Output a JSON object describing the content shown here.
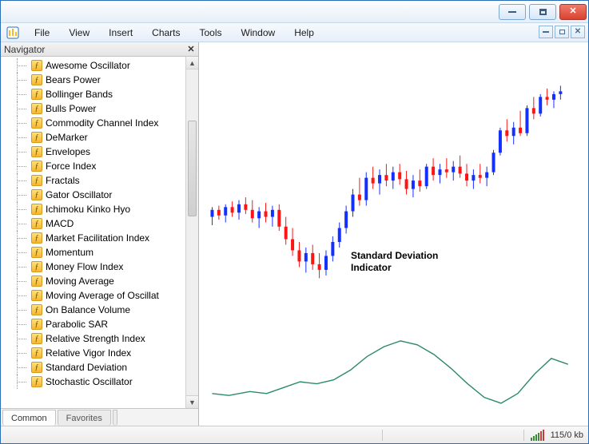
{
  "menubar": {
    "items": [
      "File",
      "View",
      "Insert",
      "Charts",
      "Tools",
      "Window",
      "Help"
    ]
  },
  "navigator": {
    "title": "Navigator",
    "indicators": [
      "Awesome Oscillator",
      "Bears Power",
      "Bollinger Bands",
      "Bulls Power",
      "Commodity Channel Index",
      "DeMarker",
      "Envelopes",
      "Force Index",
      "Fractals",
      "Gator Oscillator",
      "Ichimoku Kinko Hyo",
      "MACD",
      "Market Facilitation Index",
      "Momentum",
      "Money Flow Index",
      "Moving Average",
      "Moving Average of Oscillat",
      "On Balance Volume",
      "Parabolic SAR",
      "Relative Strength Index",
      "Relative Vigor Index",
      "Standard Deviation",
      "Stochastic Oscillator"
    ],
    "tabs": {
      "common": "Common",
      "favorites": "Favorites"
    }
  },
  "annotation": {
    "line1": "Standard Deviation",
    "line2": "Indicator"
  },
  "status": {
    "conn": "115/0 kb"
  },
  "chart_data": {
    "type": "candlestick+line",
    "colors": {
      "up": "#1430ff",
      "down": "#ff1414",
      "indicator": "#2c8a6a"
    },
    "ylim": [
      0,
      180
    ],
    "candles": [
      {
        "x": 10,
        "o": 92,
        "h": 99,
        "l": 86,
        "c": 97,
        "d": "up"
      },
      {
        "x": 18,
        "o": 97,
        "h": 100,
        "l": 90,
        "c": 93,
        "d": "down"
      },
      {
        "x": 26,
        "o": 93,
        "h": 101,
        "l": 88,
        "c": 99,
        "d": "up"
      },
      {
        "x": 34,
        "o": 99,
        "h": 103,
        "l": 92,
        "c": 95,
        "d": "down"
      },
      {
        "x": 42,
        "o": 95,
        "h": 104,
        "l": 90,
        "c": 101,
        "d": "up"
      },
      {
        "x": 50,
        "o": 101,
        "h": 106,
        "l": 94,
        "c": 97,
        "d": "down"
      },
      {
        "x": 58,
        "o": 97,
        "h": 104,
        "l": 88,
        "c": 91,
        "d": "down"
      },
      {
        "x": 66,
        "o": 91,
        "h": 99,
        "l": 84,
        "c": 96,
        "d": "up"
      },
      {
        "x": 74,
        "o": 96,
        "h": 102,
        "l": 88,
        "c": 92,
        "d": "down"
      },
      {
        "x": 82,
        "o": 92,
        "h": 100,
        "l": 85,
        "c": 97,
        "d": "up"
      },
      {
        "x": 90,
        "o": 97,
        "h": 101,
        "l": 82,
        "c": 85,
        "d": "down"
      },
      {
        "x": 98,
        "o": 85,
        "h": 92,
        "l": 72,
        "c": 76,
        "d": "down"
      },
      {
        "x": 106,
        "o": 76,
        "h": 84,
        "l": 64,
        "c": 68,
        "d": "down"
      },
      {
        "x": 114,
        "o": 68,
        "h": 74,
        "l": 56,
        "c": 60,
        "d": "down"
      },
      {
        "x": 122,
        "o": 60,
        "h": 70,
        "l": 52,
        "c": 66,
        "d": "up"
      },
      {
        "x": 130,
        "o": 66,
        "h": 72,
        "l": 54,
        "c": 58,
        "d": "down"
      },
      {
        "x": 138,
        "o": 58,
        "h": 66,
        "l": 48,
        "c": 54,
        "d": "down"
      },
      {
        "x": 146,
        "o": 54,
        "h": 68,
        "l": 50,
        "c": 64,
        "d": "up"
      },
      {
        "x": 154,
        "o": 64,
        "h": 78,
        "l": 60,
        "c": 74,
        "d": "up"
      },
      {
        "x": 162,
        "o": 74,
        "h": 88,
        "l": 70,
        "c": 84,
        "d": "up"
      },
      {
        "x": 170,
        "o": 84,
        "h": 100,
        "l": 80,
        "c": 96,
        "d": "up"
      },
      {
        "x": 178,
        "o": 96,
        "h": 112,
        "l": 92,
        "c": 108,
        "d": "up"
      },
      {
        "x": 186,
        "o": 108,
        "h": 120,
        "l": 100,
        "c": 104,
        "d": "down"
      },
      {
        "x": 194,
        "o": 104,
        "h": 124,
        "l": 100,
        "c": 120,
        "d": "up"
      },
      {
        "x": 202,
        "o": 120,
        "h": 128,
        "l": 112,
        "c": 116,
        "d": "down"
      },
      {
        "x": 210,
        "o": 116,
        "h": 126,
        "l": 108,
        "c": 122,
        "d": "up"
      },
      {
        "x": 218,
        "o": 122,
        "h": 130,
        "l": 114,
        "c": 118,
        "d": "down"
      },
      {
        "x": 226,
        "o": 118,
        "h": 128,
        "l": 112,
        "c": 124,
        "d": "up"
      },
      {
        "x": 234,
        "o": 124,
        "h": 130,
        "l": 115,
        "c": 119,
        "d": "down"
      },
      {
        "x": 242,
        "o": 119,
        "h": 125,
        "l": 108,
        "c": 112,
        "d": "down"
      },
      {
        "x": 250,
        "o": 112,
        "h": 122,
        "l": 106,
        "c": 118,
        "d": "up"
      },
      {
        "x": 258,
        "o": 118,
        "h": 126,
        "l": 110,
        "c": 114,
        "d": "down"
      },
      {
        "x": 266,
        "o": 114,
        "h": 130,
        "l": 112,
        "c": 128,
        "d": "up"
      },
      {
        "x": 274,
        "o": 128,
        "h": 134,
        "l": 118,
        "c": 122,
        "d": "down"
      },
      {
        "x": 282,
        "o": 122,
        "h": 130,
        "l": 116,
        "c": 126,
        "d": "up"
      },
      {
        "x": 290,
        "o": 126,
        "h": 134,
        "l": 120,
        "c": 124,
        "d": "down"
      },
      {
        "x": 298,
        "o": 124,
        "h": 132,
        "l": 118,
        "c": 128,
        "d": "up"
      },
      {
        "x": 306,
        "o": 128,
        "h": 136,
        "l": 120,
        "c": 123,
        "d": "down"
      },
      {
        "x": 314,
        "o": 123,
        "h": 130,
        "l": 114,
        "c": 118,
        "d": "down"
      },
      {
        "x": 322,
        "o": 118,
        "h": 126,
        "l": 112,
        "c": 122,
        "d": "up"
      },
      {
        "x": 330,
        "o": 122,
        "h": 130,
        "l": 116,
        "c": 120,
        "d": "down"
      },
      {
        "x": 338,
        "o": 120,
        "h": 128,
        "l": 114,
        "c": 124,
        "d": "up"
      },
      {
        "x": 346,
        "o": 124,
        "h": 140,
        "l": 122,
        "c": 138,
        "d": "up"
      },
      {
        "x": 354,
        "o": 138,
        "h": 156,
        "l": 136,
        "c": 154,
        "d": "up"
      },
      {
        "x": 362,
        "o": 154,
        "h": 162,
        "l": 146,
        "c": 150,
        "d": "down"
      },
      {
        "x": 370,
        "o": 150,
        "h": 160,
        "l": 144,
        "c": 156,
        "d": "up"
      },
      {
        "x": 378,
        "o": 156,
        "h": 168,
        "l": 150,
        "c": 152,
        "d": "down"
      },
      {
        "x": 386,
        "o": 152,
        "h": 172,
        "l": 150,
        "c": 170,
        "d": "up"
      },
      {
        "x": 394,
        "o": 170,
        "h": 178,
        "l": 162,
        "c": 166,
        "d": "down"
      },
      {
        "x": 402,
        "o": 166,
        "h": 180,
        "l": 164,
        "c": 178,
        "d": "up"
      },
      {
        "x": 410,
        "o": 178,
        "h": 184,
        "l": 172,
        "c": 176,
        "d": "down"
      },
      {
        "x": 418,
        "o": 176,
        "h": 182,
        "l": 170,
        "c": 180,
        "d": "up"
      },
      {
        "x": 426,
        "o": 180,
        "h": 186,
        "l": 176,
        "c": 182,
        "d": "up"
      }
    ],
    "indicator_line": [
      {
        "x": 10,
        "y": 24
      },
      {
        "x": 30,
        "y": 22
      },
      {
        "x": 55,
        "y": 26
      },
      {
        "x": 75,
        "y": 24
      },
      {
        "x": 95,
        "y": 30
      },
      {
        "x": 115,
        "y": 36
      },
      {
        "x": 135,
        "y": 34
      },
      {
        "x": 155,
        "y": 38
      },
      {
        "x": 175,
        "y": 48
      },
      {
        "x": 195,
        "y": 62
      },
      {
        "x": 215,
        "y": 72
      },
      {
        "x": 235,
        "y": 78
      },
      {
        "x": 255,
        "y": 74
      },
      {
        "x": 275,
        "y": 64
      },
      {
        "x": 295,
        "y": 50
      },
      {
        "x": 315,
        "y": 34
      },
      {
        "x": 335,
        "y": 20
      },
      {
        "x": 355,
        "y": 14
      },
      {
        "x": 375,
        "y": 24
      },
      {
        "x": 395,
        "y": 44
      },
      {
        "x": 415,
        "y": 60
      },
      {
        "x": 435,
        "y": 54
      }
    ]
  }
}
